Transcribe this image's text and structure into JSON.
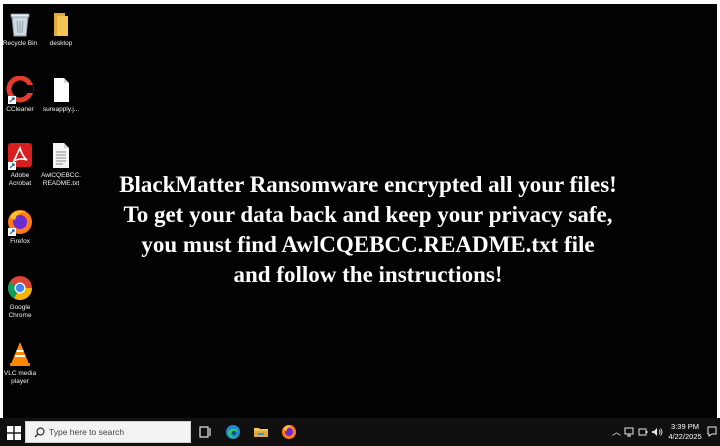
{
  "desktop": {
    "icons": [
      {
        "label": "Recycle Bin",
        "icon": "recycle-bin-icon"
      },
      {
        "label": "desktop",
        "icon": "folder-icon"
      },
      {
        "label": "CCleaner",
        "icon": "ccleaner-icon"
      },
      {
        "label": "sureapply.j...",
        "icon": "file-icon"
      },
      {
        "label": "Adobe\nAcrobat",
        "icon": "adobe-acrobat-icon"
      },
      {
        "label": "AwlCQEBCC.\nREADME.txt",
        "icon": "text-file-icon"
      },
      {
        "label": "Firefox",
        "icon": "firefox-icon"
      },
      {
        "label": "Google\nChrome",
        "icon": "chrome-icon"
      },
      {
        "label": "VLC media\nplayer",
        "icon": "vlc-icon"
      }
    ]
  },
  "ransom_note": {
    "line1": "BlackMatter Ransomware encrypted all your files!",
    "line2": "To get your data back and keep your privacy safe,",
    "line3": "you must find AwlCQEBCC.README.txt file",
    "line4": "and follow the instructions!"
  },
  "taskbar": {
    "search_placeholder": "Type here to search",
    "time": "3:39 PM",
    "date": "4/22/2025",
    "pinned": [
      "task-view-icon",
      "edge-icon",
      "file-explorer-icon",
      "firefox-icon"
    ],
    "tray": [
      "chevron-up-icon",
      "network-icon",
      "battery-icon",
      "volume-icon"
    ]
  },
  "colors": {
    "background": "#030303",
    "taskbar": "#101010",
    "text": "#ffffff"
  }
}
